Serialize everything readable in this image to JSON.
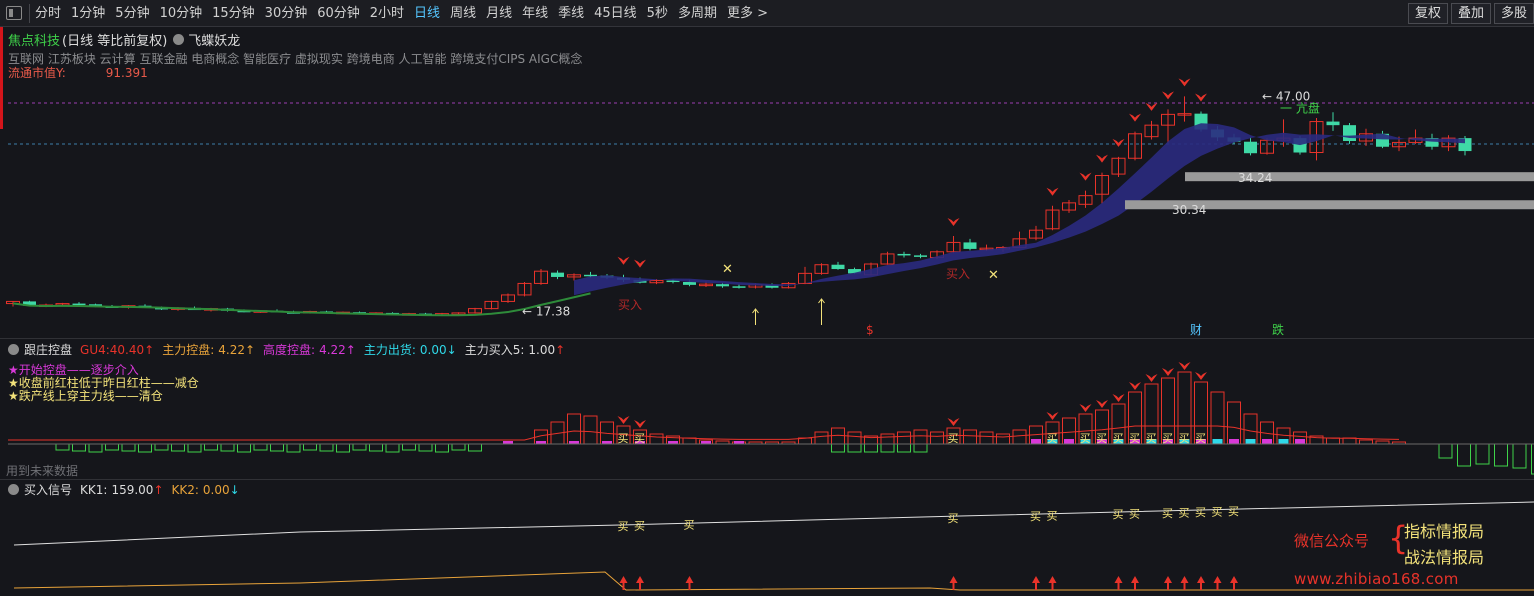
{
  "toolbar": {
    "periods": [
      "分时",
      "1分钟",
      "5分钟",
      "10分钟",
      "15分钟",
      "30分钟",
      "60分钟",
      "2小时",
      "日线",
      "周线",
      "月线",
      "年线",
      "季线",
      "45日线",
      "5秒",
      "多周期",
      "更多 >"
    ],
    "active_period": "日线",
    "right_buttons": [
      "复权",
      "叠加",
      "多股"
    ]
  },
  "main": {
    "stock_name": "焦点科技",
    "mode": "(日线 等比前复权)",
    "indicator": "飞蝶妖龙",
    "concepts": "互联网 江苏板块 云计算 互联金融 电商概念 智能医疗 虚拟现实 跨境电商 人工智能 跨境支付CIPS AIGC概念",
    "mcap_label": "流通市值Y:",
    "mcap_value": "91.391",
    "price_high": "← 47.00",
    "price_low": "← 17.38",
    "support_upper": "34.24",
    "support_lower": "30.34",
    "annot_buy": "买入",
    "annot_cai": "财",
    "annot_die": "跌",
    "annot_dollar": "$",
    "annot_hold": "一 亢盘"
  },
  "sub1": {
    "title": "跟庄控盘",
    "gu4_label": "GU4:",
    "gu4_value": "40.40",
    "zlkp_label": "主力控盘:",
    "zlkp_value": "4.22",
    "gdkp_label": "高度控盘:",
    "gdkp_value": "4.22",
    "zlch_label": "主力出货:",
    "zlch_value": "0.00",
    "zlmr_label": "主力买入5:",
    "zlmr_value": "1.00",
    "legend": [
      "★开始控盘——逐步介入",
      "★收盘前红柱低于昨日红柱——减仓",
      "★跌产线上穿主力线——清仓"
    ],
    "future_data": "用到未来数据",
    "buy_label": "买"
  },
  "sub2": {
    "title": "买入信号",
    "kk1_label": "KK1:",
    "kk1_value": "159.00",
    "kk2_label": "KK2:",
    "kk2_value": "0.00",
    "buy_label": "买"
  },
  "watermark": {
    "wechat": "微信公众号",
    "name1": "指标情报局",
    "name2": "战法情报局",
    "site": "www.zhibiao168.com"
  },
  "colors": {
    "up": "#e8332a",
    "down": "#3fd9a6",
    "ribbon": "#2a2a80",
    "yellow": "#f3e27a",
    "magenta": "#d838d8",
    "cyan": "#2fd8e8"
  }
}
